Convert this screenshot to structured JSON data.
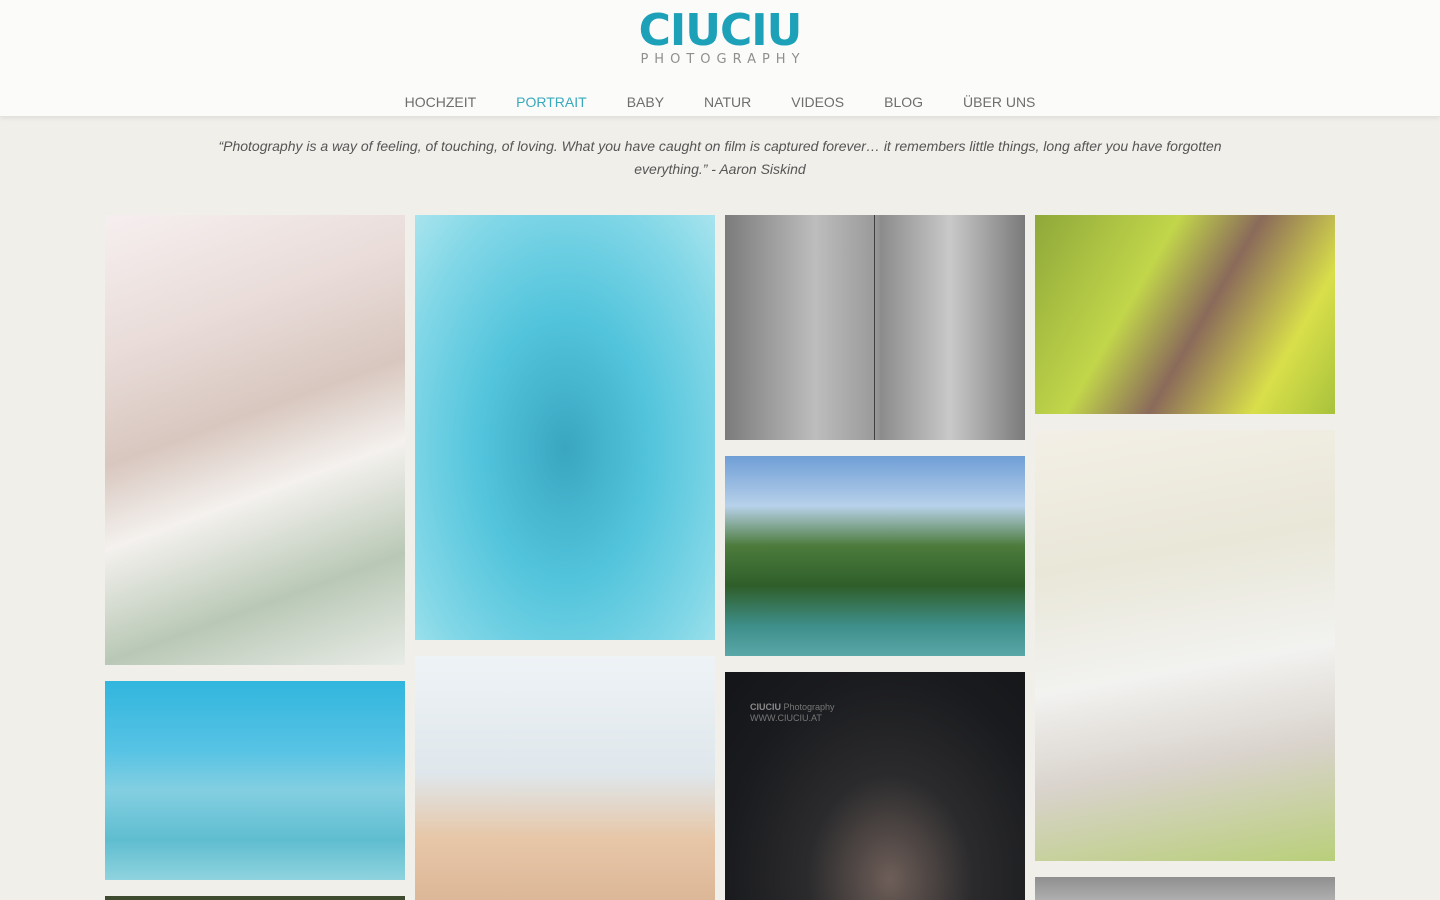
{
  "logo": {
    "name": "CIUCIU",
    "tagline": "PHOTOGRAPHY"
  },
  "nav": {
    "items": [
      {
        "label": "HOCHZEIT"
      },
      {
        "label": "PORTRAIT",
        "active": true
      },
      {
        "label": "BABY"
      },
      {
        "label": "NATUR"
      },
      {
        "label": "VIDEOS"
      },
      {
        "label": "BLOG"
      },
      {
        "label": "ÜBER UNS"
      }
    ]
  },
  "quote": {
    "text": "“Photography is a way of feeling, of touching, of loving. What you have caught on film is captured forever… it remembers little things, long after you have forgotten everything.” - Aaron Siskind"
  },
  "gallery": {
    "watermark_name": "CIUCIU",
    "watermark_suffix": " Photography",
    "watermark_url": "WWW.CIUCIU.AT"
  },
  "colors": {
    "accent": "#1ca1b9",
    "nav_active": "#3aa8bd",
    "background": "#f1efea"
  }
}
